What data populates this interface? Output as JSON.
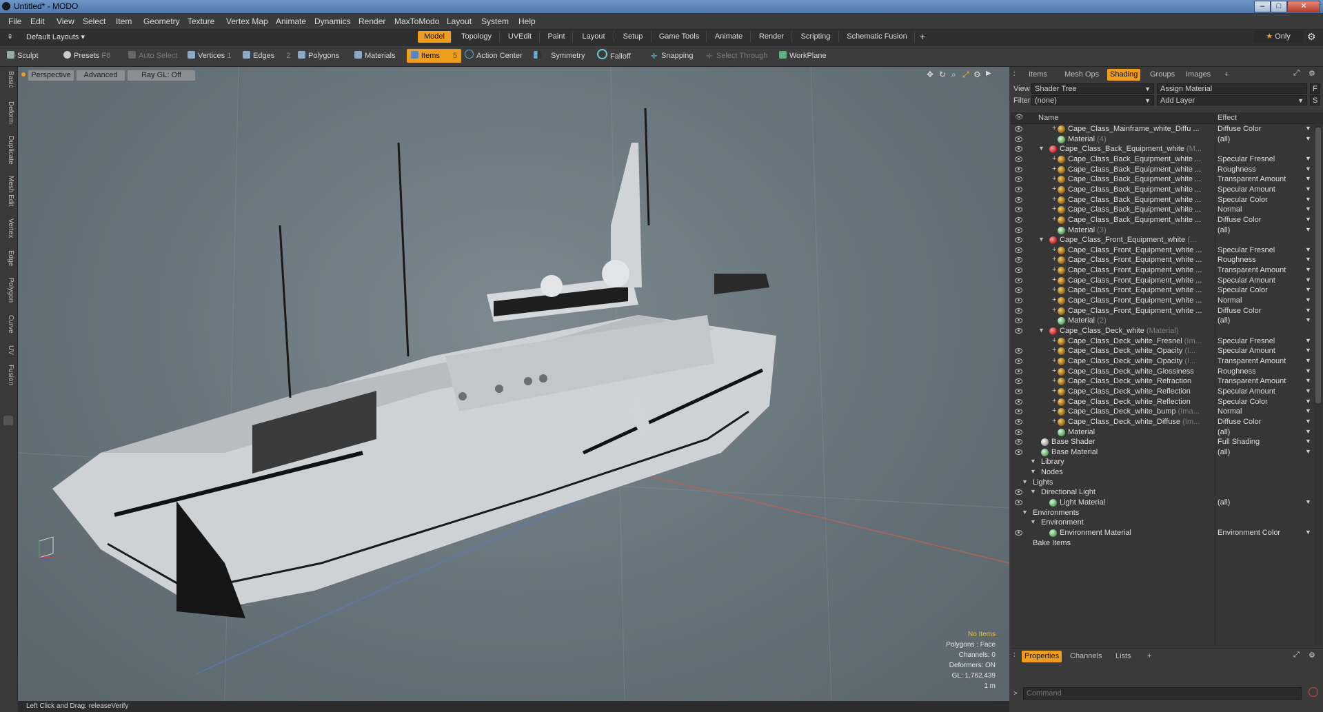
{
  "window": {
    "title": "Untitled* - MODO"
  },
  "menu": [
    "File",
    "Edit",
    "View",
    "Select",
    "Item",
    "Geometry",
    "Texture",
    "Vertex Map",
    "Animate",
    "Dynamics",
    "Render",
    "MaxToModo",
    "Layout",
    "System",
    "Help"
  ],
  "modebar": {
    "layout_label": "Default Layouts",
    "tabs": [
      "Model",
      "Topology",
      "UVEdit",
      "Paint",
      "Layout",
      "Setup",
      "Game Tools",
      "Animate",
      "Render",
      "Scripting",
      "Schematic Fusion"
    ],
    "active_tab": "Model",
    "add_label": "+",
    "only_label": "Only"
  },
  "toolbar": {
    "sculpt": "Sculpt",
    "presets": "Presets",
    "presets_key": "F6",
    "auto_select": "Auto Select",
    "vertices": "Vertices",
    "vertices_n": "1",
    "edges": "Edges",
    "edges_n": "2",
    "polygons": "Polygons",
    "materials": "Materials",
    "items": "Items",
    "items_n": "5",
    "action_center": "Action Center",
    "symmetry": "Symmetry",
    "falloff": "Falloff",
    "snapping": "Snapping",
    "select_through": "Select Through",
    "workplane": "WorkPlane"
  },
  "left_tabs": [
    "Basic",
    "Deform",
    "Duplicate",
    "Mesh Edit",
    "Vertex",
    "Edge",
    "Polygon",
    "Curve",
    "UV",
    "Fusion"
  ],
  "viewport": {
    "tabs": [
      "Perspective",
      "Advanced",
      "Ray GL: Off"
    ],
    "info": {
      "no_items": "No Items",
      "polygons": "Polygons : Face",
      "channels": "Channels: 0",
      "deformers": "Deformers: ON",
      "gl": "GL: 1,762,439",
      "scale": "1 m"
    }
  },
  "status": {
    "text": "Left Click and Drag:  releaseVerify"
  },
  "panel": {
    "tabs": [
      "Items",
      "Mesh Ops",
      "Shading",
      "Groups",
      "Images",
      "+"
    ],
    "active_tab": "Shading",
    "view_label": "View",
    "view_value": "Shader Tree",
    "assign_material": "Assign Material",
    "f_btn": "F",
    "filter_label": "Filter",
    "filter_value": "(none)",
    "add_layer": "Add Layer",
    "s_btn": "S",
    "col_name": "Name",
    "col_effect": "Effect",
    "rows": [
      {
        "indent": 3,
        "kind": "tex",
        "name": "Cape_Class_Mainframe_white_Diffu ...",
        "sub": "",
        "effect": "Diffuse Color",
        "eye": true,
        "plus": true
      },
      {
        "indent": 3,
        "kind": "mat",
        "name": "Material",
        "sub": "(4)",
        "effect": "(all)",
        "eye": true
      },
      {
        "indent": 2,
        "kind": "mask",
        "name": "Cape_Class_Back_Equipment_white",
        "sub": "(M...",
        "effect": "",
        "eye": true,
        "tri": true
      },
      {
        "indent": 3,
        "kind": "tex",
        "name": "Cape_Class_Back_Equipment_white ...",
        "sub": "",
        "effect": "Specular Fresnel",
        "eye": true,
        "plus": true
      },
      {
        "indent": 3,
        "kind": "tex",
        "name": "Cape_Class_Back_Equipment_white ...",
        "sub": "",
        "effect": "Roughness",
        "eye": true,
        "plus": true
      },
      {
        "indent": 3,
        "kind": "tex",
        "name": "Cape_Class_Back_Equipment_white ...",
        "sub": "",
        "effect": "Transparent Amount",
        "eye": true,
        "plus": true
      },
      {
        "indent": 3,
        "kind": "tex",
        "name": "Cape_Class_Back_Equipment_white ...",
        "sub": "",
        "effect": "Specular Amount",
        "eye": true,
        "plus": true
      },
      {
        "indent": 3,
        "kind": "tex",
        "name": "Cape_Class_Back_Equipment_white ...",
        "sub": "",
        "effect": "Specular Color",
        "eye": true,
        "plus": true
      },
      {
        "indent": 3,
        "kind": "tex",
        "name": "Cape_Class_Back_Equipment_white ...",
        "sub": "",
        "effect": "Normal",
        "eye": true,
        "plus": true
      },
      {
        "indent": 3,
        "kind": "tex",
        "name": "Cape_Class_Back_Equipment_white ...",
        "sub": "",
        "effect": "Diffuse Color",
        "eye": true,
        "plus": true
      },
      {
        "indent": 3,
        "kind": "mat",
        "name": "Material",
        "sub": "(3)",
        "effect": "(all)",
        "eye": true
      },
      {
        "indent": 2,
        "kind": "mask",
        "name": "Cape_Class_Front_Equipment_white",
        "sub": "(...",
        "effect": "",
        "eye": true,
        "tri": true
      },
      {
        "indent": 3,
        "kind": "tex",
        "name": "Cape_Class_Front_Equipment_white ...",
        "sub": "",
        "effect": "Specular Fresnel",
        "eye": true,
        "plus": true
      },
      {
        "indent": 3,
        "kind": "tex",
        "name": "Cape_Class_Front_Equipment_white ...",
        "sub": "",
        "effect": "Roughness",
        "eye": true,
        "plus": true
      },
      {
        "indent": 3,
        "kind": "tex",
        "name": "Cape_Class_Front_Equipment_white ...",
        "sub": "",
        "effect": "Transparent Amount",
        "eye": true,
        "plus": true
      },
      {
        "indent": 3,
        "kind": "tex",
        "name": "Cape_Class_Front_Equipment_white ...",
        "sub": "",
        "effect": "Specular Amount",
        "eye": true,
        "plus": true
      },
      {
        "indent": 3,
        "kind": "tex",
        "name": "Cape_Class_Front_Equipment_white ...",
        "sub": "",
        "effect": "Specular Color",
        "eye": true,
        "plus": true
      },
      {
        "indent": 3,
        "kind": "tex",
        "name": "Cape_Class_Front_Equipment_white ...",
        "sub": "",
        "effect": "Normal",
        "eye": true,
        "plus": true
      },
      {
        "indent": 3,
        "kind": "tex",
        "name": "Cape_Class_Front_Equipment_white ...",
        "sub": "",
        "effect": "Diffuse Color",
        "eye": true,
        "plus": true
      },
      {
        "indent": 3,
        "kind": "mat",
        "name": "Material",
        "sub": "(2)",
        "effect": "(all)",
        "eye": true
      },
      {
        "indent": 2,
        "kind": "mask",
        "name": "Cape_Class_Deck_white",
        "sub": "(Material)",
        "effect": "",
        "eye": true,
        "tri": true
      },
      {
        "indent": 3,
        "kind": "tex",
        "name": "Cape_Class_Deck_white_Fresnel",
        "sub": "(Im...",
        "effect": "Specular Fresnel",
        "eye": false,
        "plus": true
      },
      {
        "indent": 3,
        "kind": "tex",
        "name": "Cape_Class_Deck_white_Opacity",
        "sub": "(I...",
        "effect": "Specular Amount",
        "eye": true,
        "plus": true
      },
      {
        "indent": 3,
        "kind": "tex",
        "name": "Cape_Class_Deck_white_Opacity",
        "sub": "(I...",
        "effect": "Transparent Amount",
        "eye": true,
        "plus": true
      },
      {
        "indent": 3,
        "kind": "tex",
        "name": "Cape_Class_Deck_white_Glossiness",
        "sub": "",
        "effect": "Roughness",
        "eye": true,
        "plus": true
      },
      {
        "indent": 3,
        "kind": "tex",
        "name": "Cape_Class_Deck_white_Refraction",
        "sub": "",
        "effect": "Transparent Amount",
        "eye": true,
        "plus": true
      },
      {
        "indent": 3,
        "kind": "tex",
        "name": "Cape_Class_Deck_white_Reflection",
        "sub": "",
        "effect": "Specular Amount",
        "eye": true,
        "plus": true
      },
      {
        "indent": 3,
        "kind": "tex",
        "name": "Cape_Class_Deck_white_Reflection",
        "sub": "",
        "effect": "Specular Color",
        "eye": true,
        "plus": true
      },
      {
        "indent": 3,
        "kind": "tex",
        "name": "Cape_Class_Deck_white_bump",
        "sub": "(Ima...",
        "effect": "Normal",
        "eye": true,
        "plus": true
      },
      {
        "indent": 3,
        "kind": "tex",
        "name": "Cape_Class_Deck_white_Diffuse",
        "sub": "(Im...",
        "effect": "Diffuse Color",
        "eye": true,
        "plus": true
      },
      {
        "indent": 3,
        "kind": "mat",
        "name": "Material",
        "sub": "",
        "effect": "(all)",
        "eye": true
      },
      {
        "indent": 1,
        "kind": "base",
        "name": "Base Shader",
        "sub": "",
        "effect": "Full Shading",
        "eye": true
      },
      {
        "indent": 1,
        "kind": "mat",
        "name": "Base Material",
        "sub": "",
        "effect": "(all)",
        "eye": true
      },
      {
        "indent": 1,
        "kind": "none",
        "name": "Library",
        "sub": "",
        "effect": "",
        "eye": false,
        "tri": true
      },
      {
        "indent": 1,
        "kind": "none",
        "name": "Nodes",
        "sub": "",
        "effect": "",
        "eye": false,
        "tri": true
      },
      {
        "indent": 0,
        "kind": "none",
        "name": "Lights",
        "sub": "",
        "effect": "",
        "eye": false,
        "tri": true
      },
      {
        "indent": 1,
        "kind": "none",
        "name": "Directional Light",
        "sub": "",
        "effect": "",
        "eye": true,
        "tri": true
      },
      {
        "indent": 2,
        "kind": "mat",
        "name": "Light Material",
        "sub": "",
        "effect": "(all)",
        "eye": true
      },
      {
        "indent": 0,
        "kind": "none",
        "name": "Environments",
        "sub": "",
        "effect": "",
        "eye": false,
        "tri": true
      },
      {
        "indent": 1,
        "kind": "none",
        "name": "Environment",
        "sub": "",
        "effect": "",
        "eye": false,
        "tri": true
      },
      {
        "indent": 2,
        "kind": "mat",
        "name": "Environment Material",
        "sub": "",
        "effect": "Environment Color",
        "eye": true
      },
      {
        "indent": 0,
        "kind": "none",
        "name": "Bake Items",
        "sub": "",
        "effect": "",
        "eye": false
      }
    ],
    "bottom_tabs": [
      "Properties",
      "Channels",
      "Lists",
      "+"
    ],
    "bottom_active": "Properties",
    "command_placeholder": "Command"
  },
  "colors": {
    "accent": "#ef9d1f",
    "info_yellow": "#f0c040"
  }
}
